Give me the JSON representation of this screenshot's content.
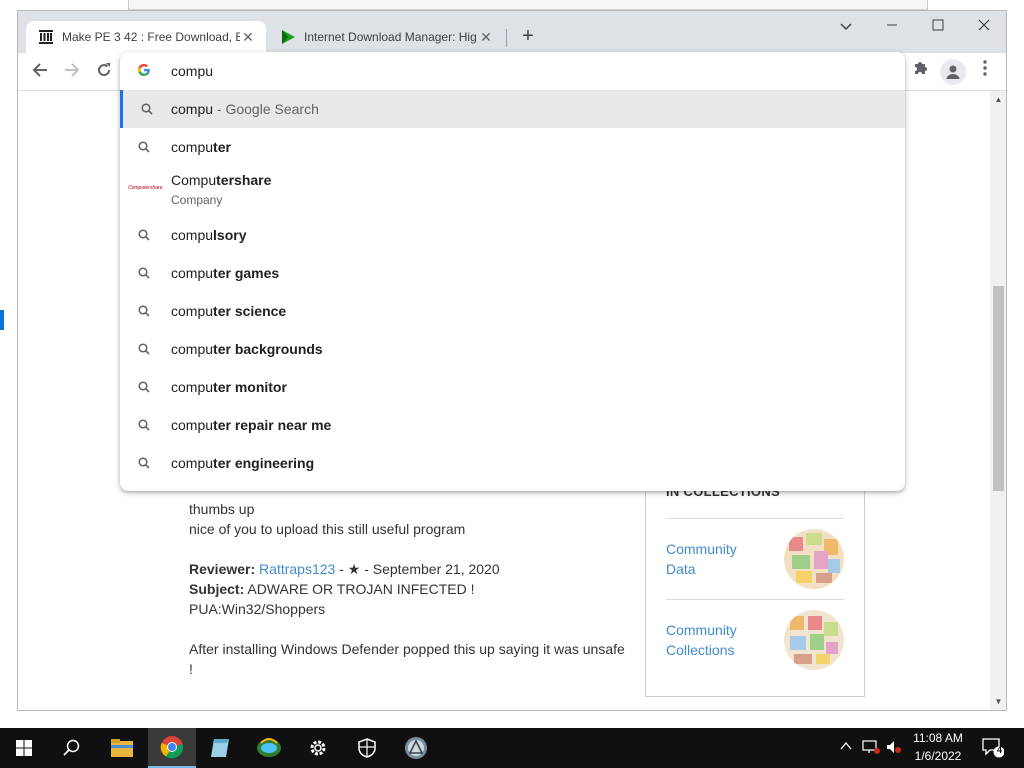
{
  "browser": {
    "tabs": [
      {
        "title": "Make PE 3 42 : Free Download, B",
        "active": true
      },
      {
        "title": "Internet Download Manager: Hig",
        "active": false
      }
    ],
    "new_tab_label": "+"
  },
  "omnibox": {
    "input_value": "compu",
    "suggestions": [
      {
        "typed": "compu",
        "completion": "",
        "suffix": " - Google Search",
        "icon": "search-icon",
        "selected": true
      },
      {
        "typed": "compu",
        "completion": "ter",
        "icon": "search-icon"
      },
      {
        "typed": "Compu",
        "completion": "tershare",
        "subtitle": "Company",
        "icon": "computershare-logo",
        "logo_text": "Computershare"
      },
      {
        "typed": "compu",
        "completion": "lsory",
        "icon": "search-icon"
      },
      {
        "typed": "compu",
        "completion": "ter games",
        "icon": "search-icon"
      },
      {
        "typed": "compu",
        "completion": "ter science",
        "icon": "search-icon"
      },
      {
        "typed": "compu",
        "completion": "ter backgrounds",
        "icon": "search-icon"
      },
      {
        "typed": "compu",
        "completion": "ter monitor",
        "icon": "search-icon"
      },
      {
        "typed": "compu",
        "completion": "ter repair near me",
        "icon": "search-icon"
      },
      {
        "typed": "compu",
        "completion": "ter engineering",
        "icon": "search-icon"
      }
    ]
  },
  "page": {
    "review1": {
      "line1": "thumbs up",
      "line2": "nice of you to upload this still useful program"
    },
    "review2": {
      "reviewer_label": "Reviewer:",
      "reviewer_name": "Rattraps123",
      "reviewer_meta": " - ★ - September 21, 2020",
      "subject_label": "Subject:",
      "subject_text": " ADWARE OR TROJAN INFECTED !",
      "body1": "PUA:Win32/Shoppers",
      "body2": "After installing Windows Defender popped this up saying it was unsafe !"
    },
    "collections": {
      "header": "IN COLLECTIONS",
      "items": [
        {
          "name": "Community Data"
        },
        {
          "name": "Community Collections"
        }
      ]
    }
  },
  "taskbar": {
    "time": "11:08 AM",
    "date": "1/6/2022",
    "notification_count": "4"
  },
  "colors": {
    "accent": "#1a73e8",
    "link": "#428bca",
    "taskbar": "#101010"
  }
}
